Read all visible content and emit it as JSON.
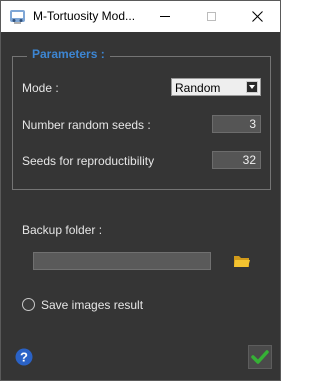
{
  "window": {
    "title": "M-Tortuosity Mod..."
  },
  "parameters": {
    "title": "Parameters :",
    "mode_label": "Mode :",
    "mode_value": "Random",
    "num_seeds_label": "Number random seeds :",
    "num_seeds_value": "3",
    "seeds_label": "Seeds for reproductibility",
    "seeds_value": "32"
  },
  "backup": {
    "label": "Backup folder :",
    "path": ""
  },
  "options": {
    "save_images_label": "Save images result",
    "save_images_checked": false
  },
  "colors": {
    "background": "#353535",
    "accent": "#3d86d3",
    "ok": "#35b135",
    "help": "#2a62c6"
  },
  "icons": [
    "app-icon",
    "minimize-icon",
    "maximize-icon",
    "close-icon",
    "dropdown-arrow-icon",
    "folder-icon",
    "help-icon",
    "checkmark-icon"
  ]
}
